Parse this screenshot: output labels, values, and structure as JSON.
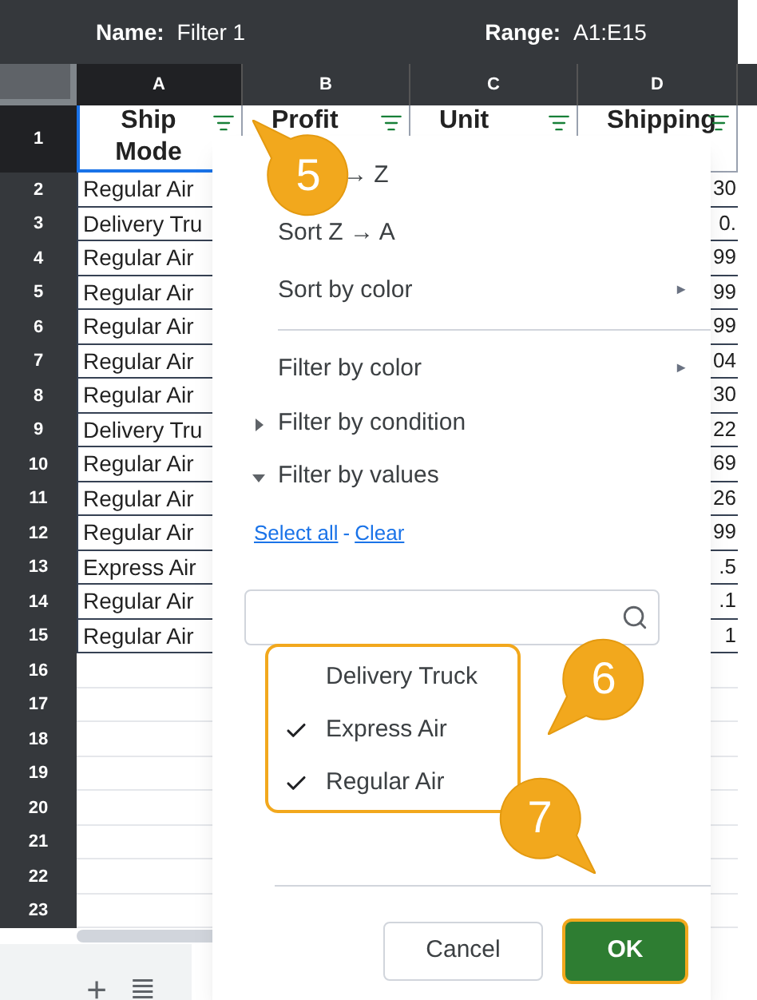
{
  "name_bar": {
    "name_label": "Name:",
    "name_value": "Filter 1",
    "range_label": "Range:",
    "range_value": "A1:E15"
  },
  "columns": [
    {
      "letter": "A",
      "header": "Ship Mode",
      "selected": true
    },
    {
      "letter": "B",
      "header": "Profit",
      "selected": false
    },
    {
      "letter": "C",
      "header": "Unit",
      "selected": false
    },
    {
      "letter": "D",
      "header": "Shipping",
      "selected": false
    }
  ],
  "header_row_number": "1",
  "rows": [
    {
      "number": "2",
      "ship_mode": "Regular Air",
      "column_d": "30"
    },
    {
      "number": "3",
      "ship_mode": "Delivery Tru",
      "column_d": "0."
    },
    {
      "number": "4",
      "ship_mode": "Regular Air",
      "column_d": "99"
    },
    {
      "number": "5",
      "ship_mode": "Regular Air",
      "column_d": "99"
    },
    {
      "number": "6",
      "ship_mode": "Regular Air",
      "column_d": "99"
    },
    {
      "number": "7",
      "ship_mode": "Regular Air",
      "column_d": "04"
    },
    {
      "number": "8",
      "ship_mode": "Regular Air",
      "column_d": "30"
    },
    {
      "number": "9",
      "ship_mode": "Delivery Tru",
      "column_d": "22"
    },
    {
      "number": "10",
      "ship_mode": "Regular Air",
      "column_d": "69"
    },
    {
      "number": "11",
      "ship_mode": "Regular Air",
      "column_d": "26"
    },
    {
      "number": "12",
      "ship_mode": "Regular Air",
      "column_d": "99"
    },
    {
      "number": "13",
      "ship_mode": "Express Air",
      "column_d": ".5"
    },
    {
      "number": "14",
      "ship_mode": "Regular Air",
      "column_d": ".1"
    },
    {
      "number": "15",
      "ship_mode": "Regular Air",
      "column_d": "1"
    }
  ],
  "empty_rows": [
    "16",
    "17",
    "18",
    "19",
    "20",
    "21",
    "22",
    "23"
  ],
  "sheet_bar": {
    "add": "+",
    "list": "≣"
  },
  "menu": {
    "items": [
      {
        "kind": "sort",
        "label": "→ Z"
      },
      {
        "kind": "sort",
        "label": "Sort Z → A"
      },
      {
        "kind": "submenu",
        "label": "Sort by color",
        "arrow": "►"
      },
      {
        "kind": "divider"
      },
      {
        "kind": "submenu",
        "label": "Filter by color",
        "arrow": "►"
      },
      {
        "kind": "section",
        "label": "Filter by condition",
        "expanded": false
      },
      {
        "kind": "section",
        "label": "Filter by values",
        "expanded": true
      }
    ],
    "select_all": "Select all",
    "separator": "-",
    "clear": "Clear",
    "values": [
      {
        "label": "Delivery Truck",
        "checked": false
      },
      {
        "label": "Express Air",
        "checked": true
      },
      {
        "label": "Regular Air",
        "checked": true
      }
    ],
    "cancel": "Cancel",
    "ok": "OK"
  },
  "callouts": [
    {
      "number": "5"
    },
    {
      "number": "6"
    },
    {
      "number": "7"
    }
  ]
}
